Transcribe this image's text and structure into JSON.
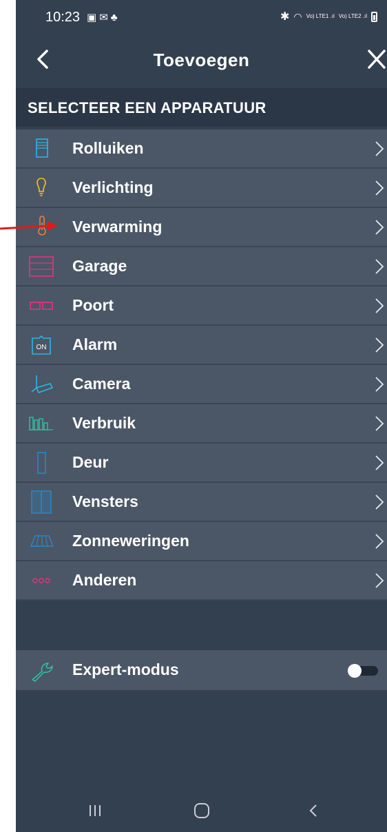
{
  "status_bar": {
    "time": "10:23",
    "left_icons": [
      "gallery-icon",
      "notification-icon",
      "app-icon"
    ],
    "right_icons": [
      "bluetooth-icon",
      "wifi-icon",
      "signal-lte1-icon",
      "signal-lte2-icon",
      "battery-icon"
    ],
    "lte1_text": "Vo) LTE1",
    "lte2_text": "Vo) LTE2"
  },
  "header": {
    "title": "Toevoegen",
    "back_icon": "chevron-left-icon",
    "close_icon": "close-icon"
  },
  "section": {
    "title": "SELECTEER EEN APPARATUUR"
  },
  "devices": [
    {
      "label": "Rolluiken",
      "icon": "shutter-icon",
      "color": "#29b6e8"
    },
    {
      "label": "Verlichting",
      "icon": "bulb-icon",
      "color": "#f5c12e"
    },
    {
      "label": "Verwarming",
      "icon": "thermometer-icon",
      "color": "#e8833a"
    },
    {
      "label": "Garage",
      "icon": "garage-icon",
      "color": "#e0357e"
    },
    {
      "label": "Poort",
      "icon": "gate-icon",
      "color": "#e0357e"
    },
    {
      "label": "Alarm",
      "icon": "alarm-on-icon",
      "color": "#29b6e8",
      "icon_text": "ON"
    },
    {
      "label": "Camera",
      "icon": "camera-icon",
      "color": "#29b6e8"
    },
    {
      "label": "Verbruik",
      "icon": "consumption-icon",
      "color": "#2ec4a0"
    },
    {
      "label": "Deur",
      "icon": "door-icon",
      "color": "#2a86c8"
    },
    {
      "label": "Vensters",
      "icon": "window-icon",
      "color": "#2a86c8"
    },
    {
      "label": "Zonneweringen",
      "icon": "awning-icon",
      "color": "#2a86c8"
    },
    {
      "label": "Anderen",
      "icon": "others-icon",
      "color": "#e0357e"
    }
  ],
  "expert_mode": {
    "label": "Expert-modus",
    "icon": "wrench-icon",
    "icon_color": "#2ec4a0",
    "enabled": false
  },
  "nav_bar": {
    "icons": [
      "recents-icon",
      "home-icon",
      "back-icon"
    ]
  },
  "annotation": {
    "arrow_color": "#e01b1b"
  }
}
